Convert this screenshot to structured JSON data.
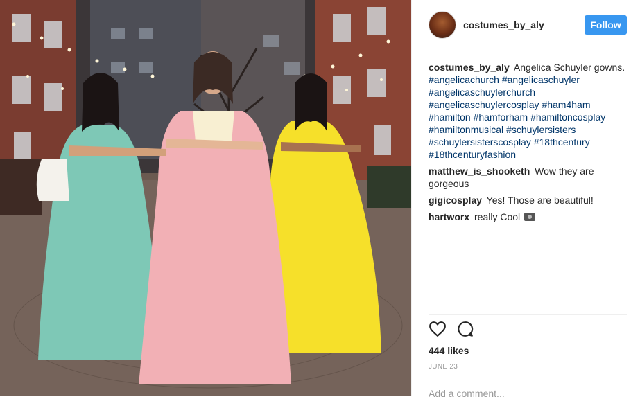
{
  "post": {
    "photo_alt": "Three women in Angelica, Eliza and Peggy Schuyler ball gowns",
    "author": {
      "username": "costumes_by_aly",
      "avatar_icon": "avatar"
    },
    "follow_label": "Follow",
    "caption": {
      "user": "costumes_by_aly",
      "text": "Angelica Schuyler gowns.",
      "hashtags": [
        "#angelicachurch",
        "#angelicaschuyler",
        "#angelicaschuylerchurch",
        "#angelicaschuylercosplay",
        "#ham4ham",
        "#hamilton",
        "#hamforham",
        "#hamiltoncosplay",
        "#hamiltonmusical",
        "#schuylersisters",
        "#schuylersisterscosplay",
        "#18thcentury",
        "#18thcenturyfashion"
      ]
    },
    "comments": [
      {
        "user": "matthew_is_shooketh",
        "text": "Wow they are gorgeous"
      },
      {
        "user": "gigicosplay",
        "text": "Yes! Those are beautiful!"
      },
      {
        "user": "hartworx",
        "text": "really Cool",
        "emoji": "camera-icon"
      }
    ],
    "likes": "444 likes",
    "date": "JUNE 23",
    "add_comment_placeholder": "Add a comment...",
    "colors": {
      "follow": "#3897f0",
      "hashtag": "#003569",
      "gown_left": "#7ec8b6",
      "gown_center": "#f2b0b5",
      "gown_right": "#f6e02a"
    }
  }
}
